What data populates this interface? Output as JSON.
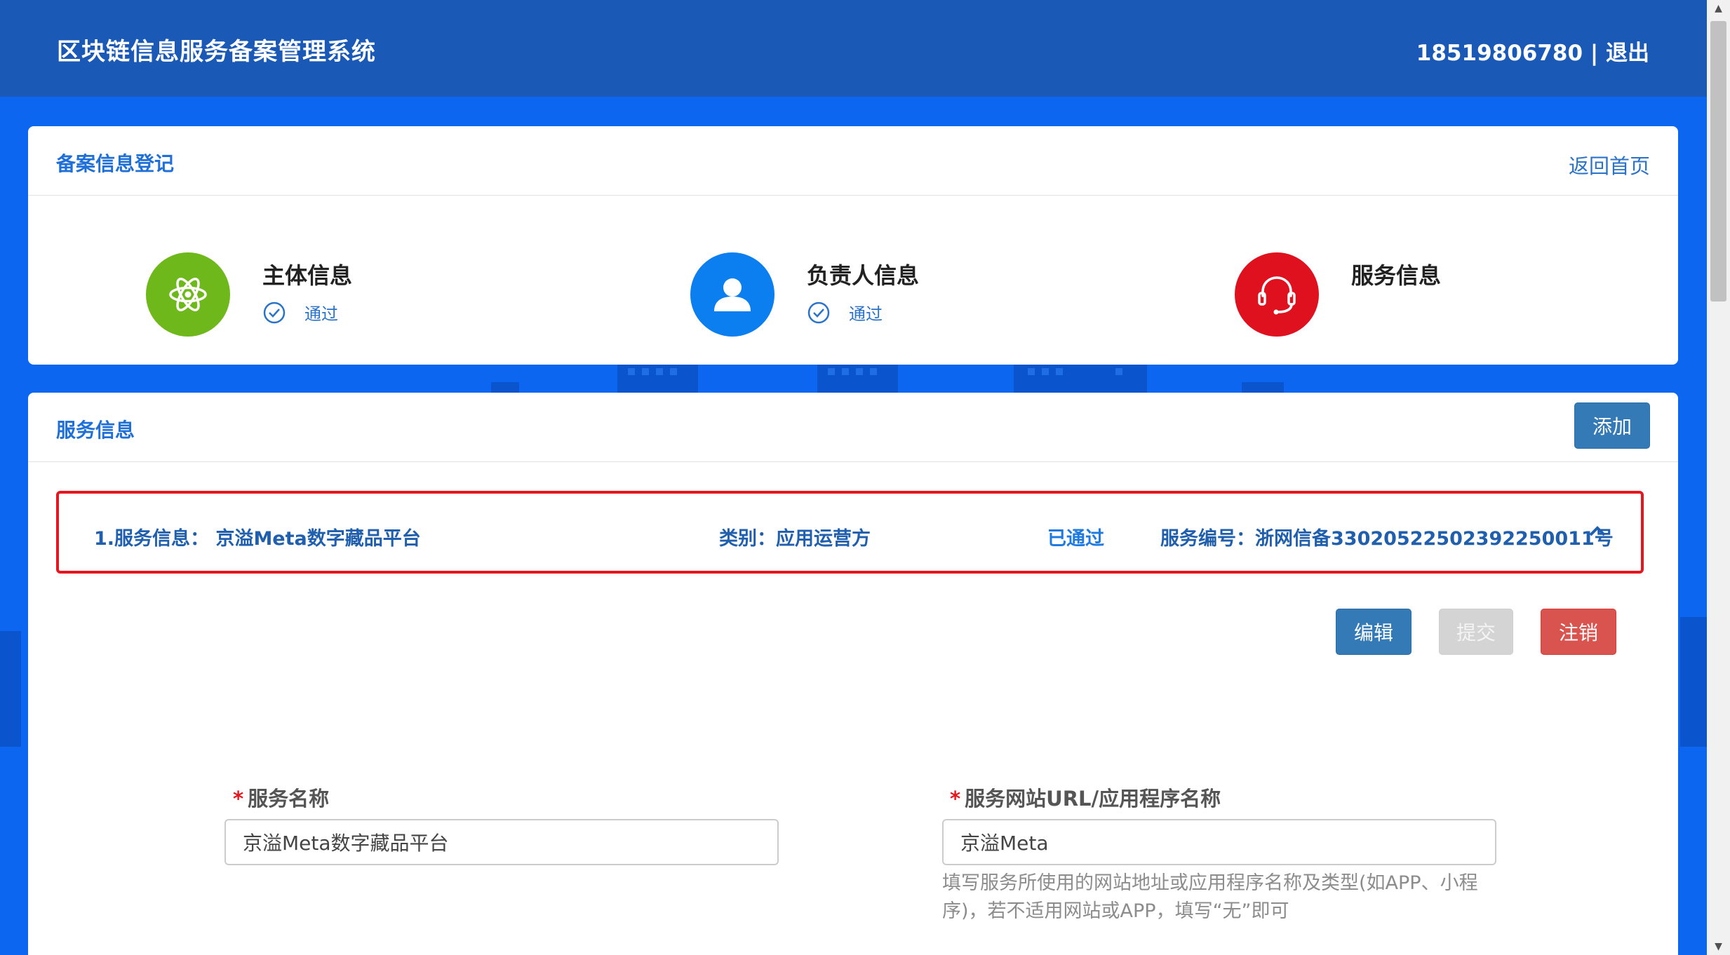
{
  "header": {
    "app_title": "区块链信息服务备案管理系统",
    "phone": "18519806780",
    "separator": "|",
    "logout": "退出"
  },
  "registration_card": {
    "title": "备案信息登记",
    "back_home": "返回首页",
    "steps": [
      {
        "label": "主体信息",
        "status": "通过",
        "icon": "atom-icon",
        "color": "#6eb81b"
      },
      {
        "label": "负责人信息",
        "status": "通过",
        "icon": "person-icon",
        "color": "#0b7ef0"
      },
      {
        "label": "服务信息",
        "status": "",
        "icon": "headset-icon",
        "color": "#e0111f"
      }
    ]
  },
  "service_card": {
    "title": "服务信息",
    "add_button": "添加",
    "row": {
      "service_info": "1.服务信息：  京溢Meta数字藏品平台",
      "category": "类别：应用运营方",
      "status": "已通过",
      "service_number": "服务编号：浙网信备33020522502392250011号"
    },
    "actions": {
      "edit": "编辑",
      "submit": "提交",
      "cancel": "注销"
    },
    "form": {
      "required_mark": "*",
      "service_name_label": "服务名称",
      "service_name_value": "京溢Meta数字藏品平台",
      "url_label": "服务网站URL/应用程序名称",
      "url_value": "京溢Meta",
      "url_help": "填写服务所使用的网站地址或应用程序名称及类型(如APP、小程序)，若不适用网站或APP，填写“无”即可"
    }
  },
  "colors": {
    "background": "#0d66f0",
    "header": "#1a5ab6",
    "accent": "#337ab7",
    "danger": "#d9534f",
    "highlight_border": "#e5161d"
  }
}
